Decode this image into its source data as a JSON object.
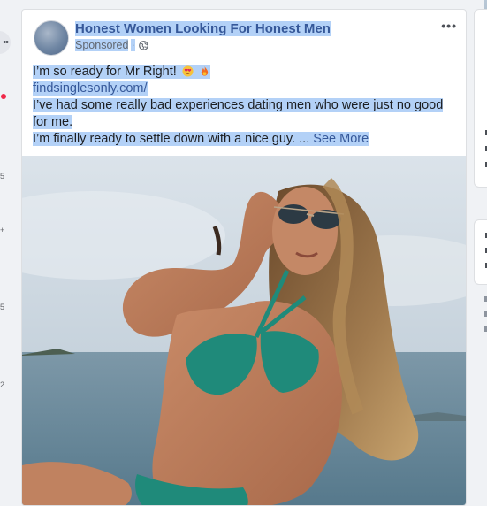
{
  "post": {
    "page_name": "Honest Women Looking For Honest Men",
    "sponsored_label": "Sponsored",
    "separator": "·",
    "more_label": "•••",
    "text_line_1": "I’m so ready for Mr Right!",
    "link_text": "findsinglesonly.com/",
    "text_line_3": "I’ve had some really bad experiences dating men who were just no good for me.",
    "text_line_4": "I’m finally ready to settle down with a nice guy. ...",
    "see_more": "See More",
    "emojis": [
      "heart-eyes-emoji",
      "fire-emoji"
    ]
  },
  "left_rail": {
    "button_label": "••",
    "numbers": [
      "5",
      "+",
      "5",
      "2"
    ]
  },
  "colors": {
    "link": "#365899",
    "highlight": "#b3d1f7",
    "notification": "#f02849"
  }
}
